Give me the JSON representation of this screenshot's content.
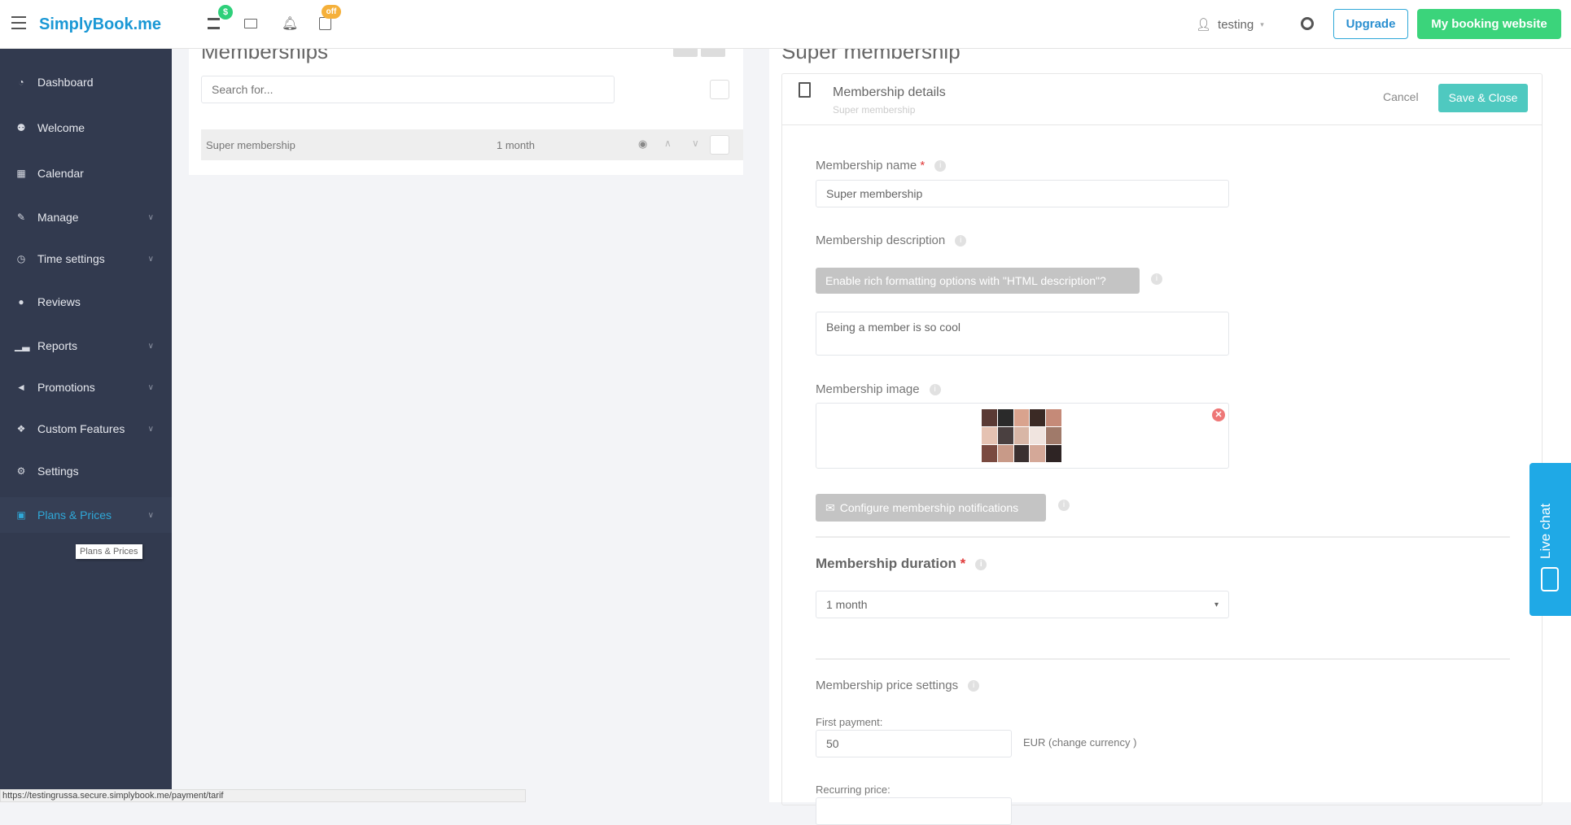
{
  "topbar": {
    "logo": "SimplyBook.me",
    "badge_dollar": "$",
    "badge_off": "off",
    "user": "testing",
    "upgrade": "Upgrade",
    "booking_site": "My booking website"
  },
  "sidebar": {
    "items": [
      {
        "label": "Dashboard",
        "icon": "dashboard-icon",
        "chevron": false
      },
      {
        "label": "Welcome",
        "icon": "bulb-icon",
        "chevron": false
      },
      {
        "label": "Calendar",
        "icon": "calendar-icon",
        "chevron": false
      },
      {
        "label": "Manage",
        "icon": "pencil-icon",
        "chevron": true
      },
      {
        "label": "Time settings",
        "icon": "clock-icon",
        "chevron": true
      },
      {
        "label": "Reviews",
        "icon": "comments-icon",
        "chevron": false
      },
      {
        "label": "Reports",
        "icon": "bar-chart-icon",
        "chevron": true
      },
      {
        "label": "Promotions",
        "icon": "bullhorn-icon",
        "chevron": true
      },
      {
        "label": "Custom Features",
        "icon": "puzzle-icon",
        "chevron": true
      },
      {
        "label": "Settings",
        "icon": "gears-icon",
        "chevron": false
      },
      {
        "label": "Plans & Prices",
        "icon": "money-icon",
        "chevron": true,
        "active": true
      }
    ],
    "tooltip": "Plans & Prices"
  },
  "list": {
    "title": "Memberships",
    "search_placeholder": "Search for...",
    "rows": [
      {
        "name": "Super membership",
        "duration": "1 month"
      }
    ]
  },
  "detail": {
    "title": "Super membership",
    "header": "Membership details",
    "subheader": "Super membership",
    "cancel": "Cancel",
    "save": "Save & Close",
    "name_label": "Membership name",
    "name_value": "Super membership",
    "desc_label": "Membership description",
    "html_btn": "Enable rich formatting options with \"HTML description\"?",
    "desc_value": "Being a member is so cool",
    "image_label": "Membership image",
    "notif_btn": "Configure membership notifications",
    "duration_label": "Membership duration",
    "duration_value": "1 month",
    "price_label": "Membership price settings",
    "first_payment_label": "First payment:",
    "first_payment_value": "50",
    "currency": "EUR (change currency )",
    "recurring_label": "Recurring price:"
  },
  "live_chat": "Live chat",
  "status_url": "https://testingrussa.secure.simplybook.me/payment/tarif",
  "colors": {
    "sidebar": "#323a4f",
    "accent": "#2fa8d8",
    "save": "#4fc9c0",
    "green": "#3bd47b",
    "chat": "#1fa9e6"
  }
}
